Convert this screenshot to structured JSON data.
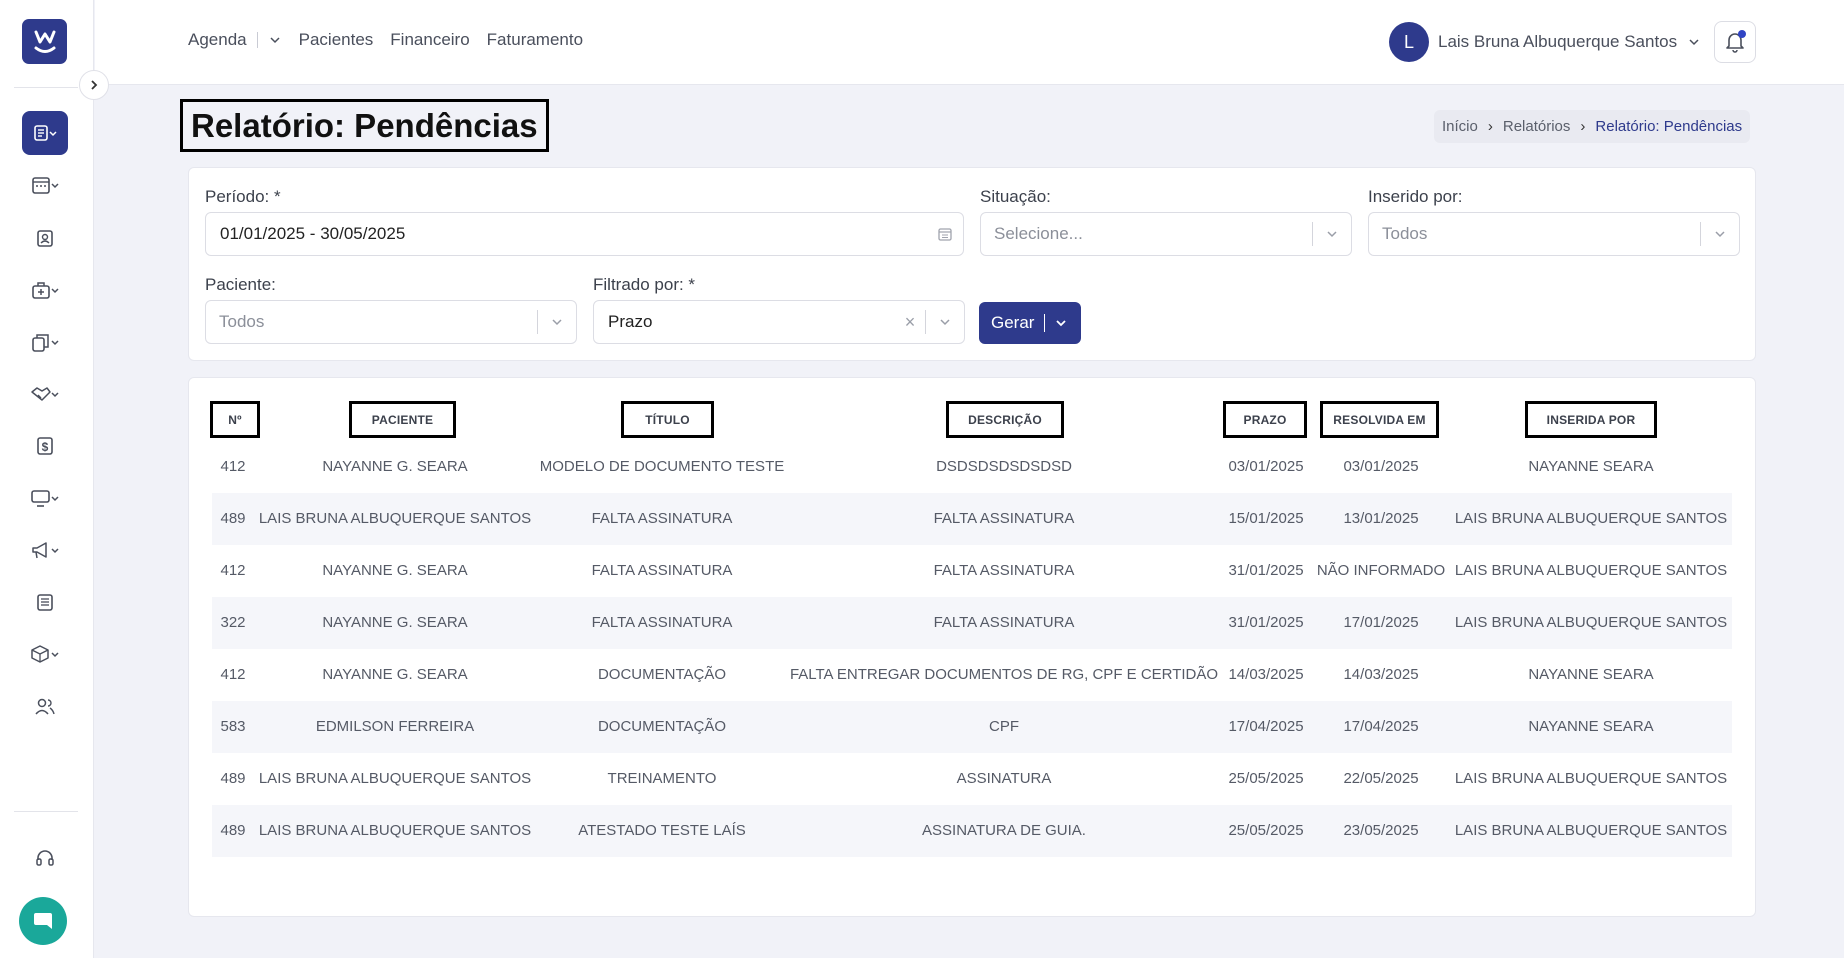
{
  "colors": {
    "brand": "#2e3a8c",
    "chat": "#1aa89a",
    "row_alt": "#f5f6fa"
  },
  "sidebar": {
    "logo_icon": "w-logo-icon",
    "items": [
      {
        "name": "reports-icon",
        "active": true
      },
      {
        "name": "calendar-icon"
      },
      {
        "name": "patient-badge-icon"
      },
      {
        "name": "medical-case-icon"
      },
      {
        "name": "documents-icon"
      },
      {
        "name": "handshake-icon"
      },
      {
        "name": "dollar-icon"
      },
      {
        "name": "monitor-icon"
      },
      {
        "name": "megaphone-icon"
      },
      {
        "name": "newspaper-icon"
      },
      {
        "name": "box-icon"
      },
      {
        "name": "users-icon"
      },
      {
        "name": "headset-icon"
      }
    ]
  },
  "nav": {
    "agenda": "Agenda",
    "pacientes": "Pacientes",
    "financeiro": "Financeiro",
    "faturamento": "Faturamento"
  },
  "user": {
    "initial": "L",
    "name": "Lais Bruna Albuquerque Santos"
  },
  "page": {
    "title": "Relatório: Pendências"
  },
  "breadcrumb": {
    "home": "Início",
    "reports": "Relatórios",
    "current": "Relatório: Pendências"
  },
  "filters": {
    "periodo_label": "Período: *",
    "periodo_value": "01/01/2025 - 30/05/2025",
    "situacao_label": "Situação:",
    "situacao_placeholder": "Selecione...",
    "inserido_label": "Inserido por:",
    "inserido_value": "Todos",
    "paciente_label": "Paciente:",
    "paciente_value": "Todos",
    "filtrado_label": "Filtrado por: *",
    "filtrado_value": "Prazo",
    "gerar_label": "Gerar"
  },
  "table": {
    "headers": {
      "numero": "Nº",
      "paciente": "PACIENTE",
      "titulo": "TÍTULO",
      "descricao": "DESCRIÇÃO",
      "prazo": "PRAZO",
      "resolvida": "RESOLVIDA EM",
      "inserida": "INSERIDA POR"
    },
    "rows": [
      {
        "numero": "412",
        "paciente": "NAYANNE G. SEARA",
        "titulo": "MODELO DE DOCUMENTO TESTE",
        "descricao": "DSDSDSDSDSDSD",
        "prazo": "03/01/2025",
        "resolvida": "03/01/2025",
        "inserida": "NAYANNE SEARA"
      },
      {
        "numero": "489",
        "paciente": "LAIS BRUNA ALBUQUERQUE SANTOS",
        "titulo": "FALTA ASSINATURA",
        "descricao": "FALTA ASSINATURA",
        "prazo": "15/01/2025",
        "resolvida": "13/01/2025",
        "inserida": "LAIS BRUNA ALBUQUERQUE SANTOS"
      },
      {
        "numero": "412",
        "paciente": "NAYANNE G. SEARA",
        "titulo": "FALTA ASSINATURA",
        "descricao": "FALTA ASSINATURA",
        "prazo": "31/01/2025",
        "resolvida": "NÃO INFORMADO",
        "inserida": "LAIS BRUNA ALBUQUERQUE SANTOS"
      },
      {
        "numero": "322",
        "paciente": "NAYANNE G. SEARA",
        "titulo": "FALTA ASSINATURA",
        "descricao": "FALTA ASSINATURA",
        "prazo": "31/01/2025",
        "resolvida": "17/01/2025",
        "inserida": "LAIS BRUNA ALBUQUERQUE SANTOS"
      },
      {
        "numero": "412",
        "paciente": "NAYANNE G. SEARA",
        "titulo": "DOCUMENTAÇÃO",
        "descricao": "FALTA ENTREGAR DOCUMENTOS DE RG, CPF E CERTIDÃO",
        "prazo": "14/03/2025",
        "resolvida": "14/03/2025",
        "inserida": "NAYANNE SEARA"
      },
      {
        "numero": "583",
        "paciente": "EDMILSON FERREIRA",
        "titulo": "DOCUMENTAÇÃO",
        "descricao": "CPF",
        "prazo": "17/04/2025",
        "resolvida": "17/04/2025",
        "inserida": "NAYANNE SEARA"
      },
      {
        "numero": "489",
        "paciente": "LAIS BRUNA ALBUQUERQUE SANTOS",
        "titulo": "TREINAMENTO",
        "descricao": "ASSINATURA",
        "prazo": "25/05/2025",
        "resolvida": "22/05/2025",
        "inserida": "LAIS BRUNA ALBUQUERQUE SANTOS"
      },
      {
        "numero": "489",
        "paciente": "LAIS BRUNA ALBUQUERQUE SANTOS",
        "titulo": "ATESTADO TESTE LAÍS",
        "descricao": "ASSINATURA DE GUIA.",
        "prazo": "25/05/2025",
        "resolvida": "23/05/2025",
        "inserida": "LAIS BRUNA ALBUQUERQUE SANTOS"
      }
    ]
  }
}
